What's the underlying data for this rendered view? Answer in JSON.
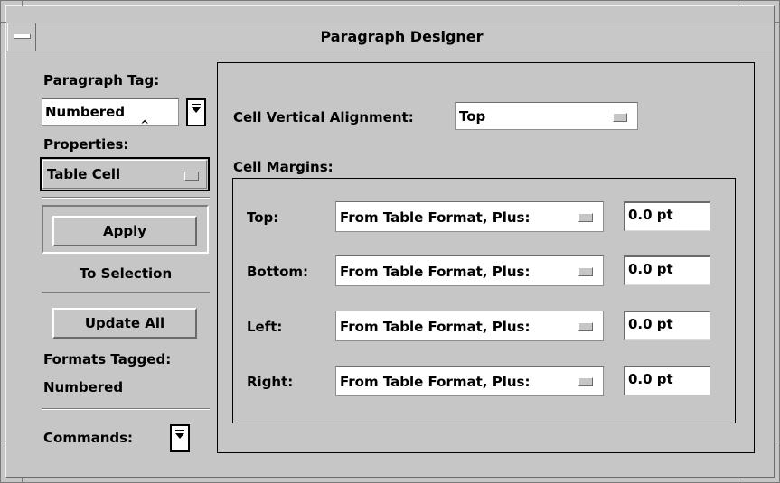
{
  "window": {
    "title": "Paragraph Designer"
  },
  "left": {
    "paragraph_tag_label": "Paragraph Tag:",
    "paragraph_tag_value": "Numbered",
    "properties_label": "Properties:",
    "properties_value": "Table Cell",
    "apply_label": "Apply",
    "to_selection_label": "To Selection",
    "update_all_label": "Update All",
    "formats_tagged_label": "Formats Tagged:",
    "formats_tagged_value": "Numbered",
    "commands_label": "Commands:"
  },
  "main": {
    "vertical_alignment_label": "Cell Vertical Alignment:",
    "vertical_alignment_value": "Top",
    "cell_margins_label": "Cell Margins:",
    "margins": [
      {
        "label": "Top:",
        "mode": "From Table Format, Plus:",
        "value": "0.0 pt"
      },
      {
        "label": "Bottom:",
        "mode": "From Table Format, Plus:",
        "value": "0.0 pt"
      },
      {
        "label": "Left:",
        "mode": "From Table Format, Plus:",
        "value": "0.0 pt"
      },
      {
        "label": "Right:",
        "mode": "From Table Format, Plus:",
        "value": "0.0 pt"
      }
    ]
  }
}
